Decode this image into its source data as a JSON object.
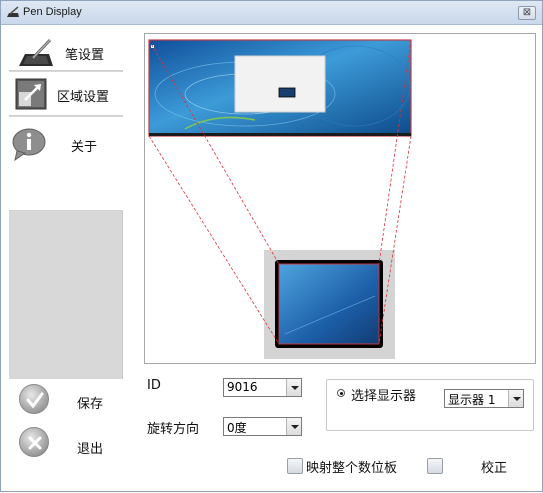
{
  "window": {
    "title": "Pen Display",
    "close_glyph": "⊠"
  },
  "sidebar": {
    "items": [
      {
        "label": "笔设置",
        "icon": "pen-tablet-icon"
      },
      {
        "label": "区域设置",
        "icon": "area-mapping-icon"
      },
      {
        "label": "关于",
        "icon": "info-icon"
      }
    ]
  },
  "actions": {
    "save_label": "保存",
    "exit_label": "退出"
  },
  "settings": {
    "id_label": "ID",
    "id_value": "9016",
    "rotation_label": "旋转方向",
    "rotation_value": "0度",
    "select_display_label": "选择显示器",
    "display_value": "显示器 1",
    "map_tablet_label": "映射整个数位板",
    "calibrate_label": "校正"
  },
  "colors": {
    "mapping_line": "#e0303a",
    "screen_blue": "#1f6fb5",
    "sidebar_gray": "#d8d8d8"
  }
}
